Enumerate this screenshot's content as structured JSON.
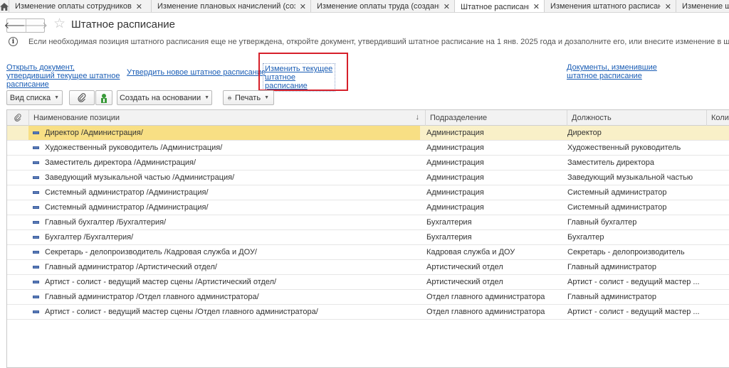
{
  "tabs": [
    {
      "label": "Изменение оплаты сотрудников",
      "close": "✕",
      "width": 200,
      "active": false
    },
    {
      "label": "Изменение плановых начислений (соз...",
      "close": "✕",
      "width": 224,
      "active": false
    },
    {
      "label": "Изменение оплаты труда (создание)",
      "close": "✕",
      "width": 202,
      "active": false
    },
    {
      "label": "Штатное расписание",
      "close": "✕",
      "width": 126,
      "active": true
    },
    {
      "label": "Изменения штатного расписания",
      "close": "✕",
      "width": 185,
      "active": false
    },
    {
      "label": "Изменение шта",
      "close": "",
      "width": 120,
      "active": false
    }
  ],
  "header": {
    "back": "🡐",
    "forward": "🡒",
    "star": "☆",
    "title": "Штатное расписание"
  },
  "info": {
    "icon": "i",
    "text": "Если необходимая позиция штатного расписания еще не утверждена, откройте документ, утвердивший штатное расписание на 1 янв. 2025 года и дозаполните его, или внесите изменение в штатное расписание."
  },
  "links": {
    "open_doc": "Открыть документ, утвердивший текущее штатное расписание",
    "approve_new": "Утвердить новое штатное расписание",
    "change_current": "Изменить текущее штатное расписание",
    "docs_changed": "Документы, изменившие штатное расписание"
  },
  "toolbar": {
    "view_list": "Вид списка",
    "create_based": "Создать на основании",
    "print": "Печать"
  },
  "table": {
    "columns": {
      "attach": "",
      "name": "Наименование позиции",
      "dept": "Подразделение",
      "position": "Должность",
      "count": "Количество"
    },
    "sort": "↓",
    "rows": [
      {
        "name": "Директор /Администрация/",
        "dept": "Администрация",
        "position": "Директор"
      },
      {
        "name": "Художественный руководитель /Администрация/",
        "dept": "Администрация",
        "position": "Художественный руководитель"
      },
      {
        "name": "Заместитель директора /Администрация/",
        "dept": "Администрация",
        "position": "Заместитель директора"
      },
      {
        "name": "Заведующий музыкальной частью /Администрация/",
        "dept": "Администрация",
        "position": "Заведующий музыкальной частью"
      },
      {
        "name": "Системный администратор /Администрация/",
        "dept": "Администрация",
        "position": "Системный администратор"
      },
      {
        "name": "Системный администратор /Администрация/",
        "dept": "Администрация",
        "position": "Системный администратор"
      },
      {
        "name": "Главный бухгалтер /Бухгалтерия/",
        "dept": "Бухгалтерия",
        "position": "Главный бухгалтер"
      },
      {
        "name": "Бухгалтер /Бухгалтерия/",
        "dept": "Бухгалтерия",
        "position": "Бухгалтер"
      },
      {
        "name": "Секретарь - делопроизводитель /Кадровая служба и ДОУ/",
        "dept": "Кадровая служба и ДОУ",
        "position": "Секретарь - делопроизводитель"
      },
      {
        "name": "Главный администратор /Артистический отдел/",
        "dept": "Артистический отдел",
        "position": "Главный администратор"
      },
      {
        "name": "Артист - солист - ведущий мастер сцены /Артистический отдел/",
        "dept": "Артистический отдел",
        "position": "Артист - солист - ведущий мастер ..."
      },
      {
        "name": "Главный администратор /Отдел главного администратора/",
        "dept": "Отдел главного администратора",
        "position": "Главный администратор"
      },
      {
        "name": "Артист - солист - ведущий мастер сцены /Отдел главного администратора/",
        "dept": "Отдел главного администратора",
        "position": "Артист - солист - ведущий мастер ..."
      }
    ]
  }
}
